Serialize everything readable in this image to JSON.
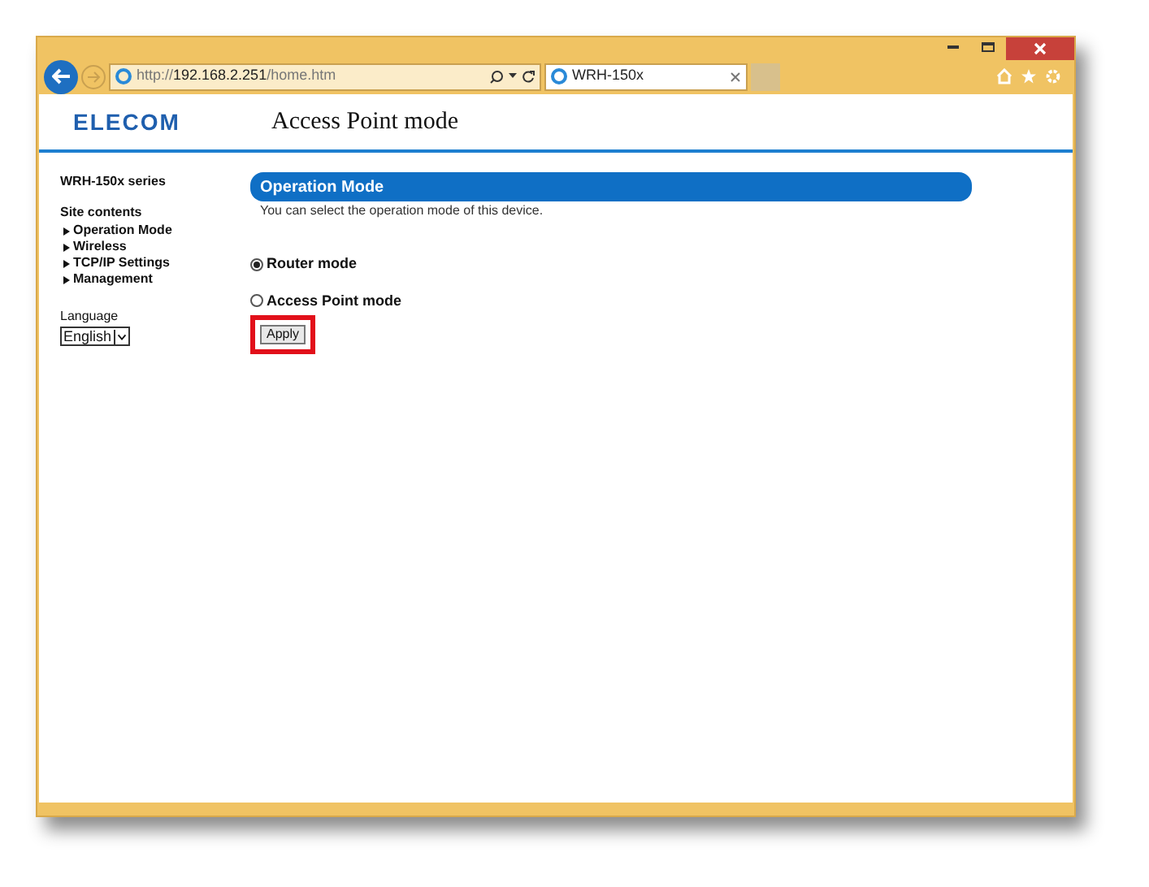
{
  "browser": {
    "url_scheme": "http://",
    "url_host": "192.168.2.251",
    "url_path": "/home.htm",
    "tab_title": "WRH-150x"
  },
  "header": {
    "logo": "ELECOM",
    "title": "Access Point mode"
  },
  "sidebar": {
    "series": "WRH-150x series",
    "contents_heading": "Site contents",
    "links": [
      {
        "label": "Operation Mode"
      },
      {
        "label": "Wireless"
      },
      {
        "label": "TCP/IP Settings"
      },
      {
        "label": "Management"
      }
    ],
    "language_label": "Language",
    "language_value": "English"
  },
  "main": {
    "section_title": "Operation Mode",
    "description": "You can select the operation mode of this device.",
    "radios": [
      {
        "label": "Router mode",
        "selected": true
      },
      {
        "label": "Access Point mode",
        "selected": false
      }
    ],
    "apply_button": "Apply",
    "apply_highlighted": true
  }
}
